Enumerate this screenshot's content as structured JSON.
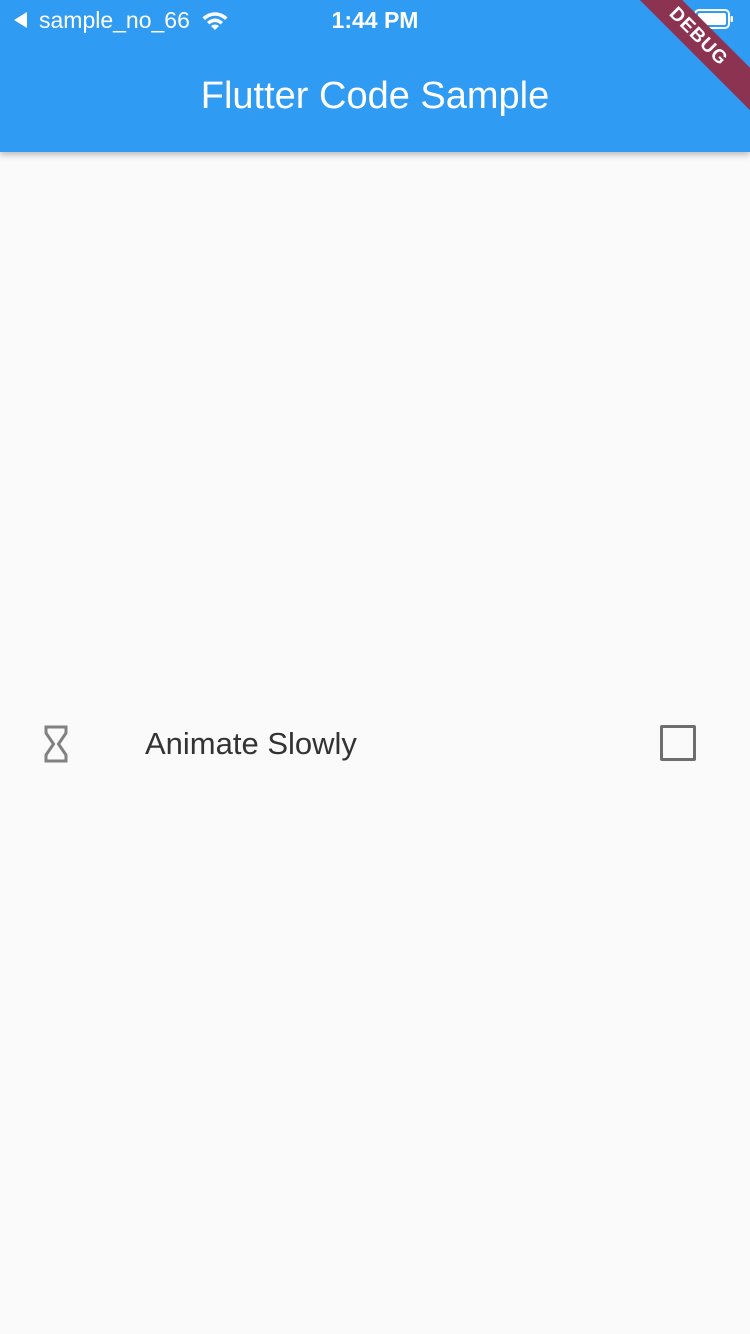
{
  "status_bar": {
    "back_app": "sample_no_66",
    "time": "1:44 PM",
    "icons": [
      "back-arrow-icon",
      "wifi-icon",
      "battery-icon"
    ]
  },
  "app_bar": {
    "title": "Flutter Code Sample",
    "color": "#2f9bf2"
  },
  "debug_banner": {
    "label": "DEBUG",
    "color": "#8d3352"
  },
  "list_tile": {
    "icon": "hourglass-icon",
    "label": "Animate Slowly",
    "checked": false
  },
  "colors": {
    "background": "#fafafa",
    "text": "#333333",
    "icon": "#808080"
  }
}
